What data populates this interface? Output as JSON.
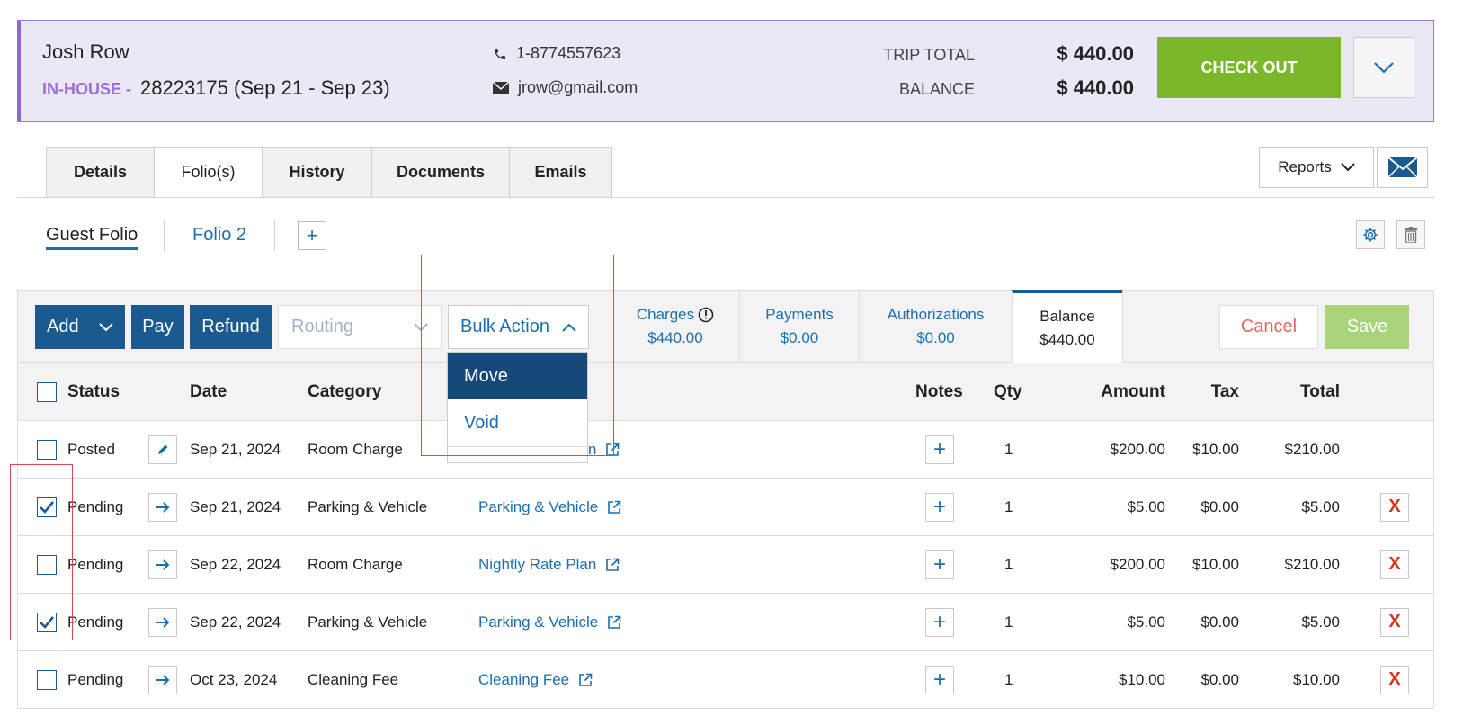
{
  "header": {
    "guest_name": "Josh Row",
    "status": "IN-HOUSE -",
    "reservation": "28223175 (Sep 21 - Sep 23)",
    "phone": "1-8774557623",
    "email": "jrow@gmail.com",
    "trip_total_label": "TRIP TOTAL",
    "trip_total_value": "$ 440.00",
    "balance_label": "BALANCE",
    "balance_value": "$ 440.00",
    "checkout_label": "CHECK OUT"
  },
  "tabs": [
    "Details",
    "Folio(s)",
    "History",
    "Documents",
    "Emails"
  ],
  "active_tab": "Folio(s)",
  "reports_label": "Reports",
  "folios": {
    "guest": "Guest Folio",
    "second": "Folio 2",
    "add": "+"
  },
  "toolbar": {
    "add": "Add",
    "pay": "Pay",
    "refund": "Refund",
    "routing_placeholder": "Routing",
    "bulk_action": "Bulk Action",
    "cancel": "Cancel",
    "save": "Save"
  },
  "summary": [
    {
      "label": "Charges",
      "value": "$440.00"
    },
    {
      "label": "Payments",
      "value": "$0.00"
    },
    {
      "label": "Authorizations",
      "value": "$0.00"
    },
    {
      "label": "Balance",
      "value": "$440.00"
    }
  ],
  "bulk_menu": [
    "Move",
    "Void"
  ],
  "table": {
    "columns": [
      "Status",
      "Date",
      "Category",
      "Notes",
      "Qty",
      "Amount",
      "Tax",
      "Total"
    ],
    "rows": [
      {
        "checked": false,
        "status": "Posted",
        "date": "Sep 21, 2024",
        "category": "Room Charge",
        "item": "n",
        "qty": "1",
        "amount": "$200.00",
        "tax": "$10.00",
        "total": "$210.00"
      },
      {
        "checked": true,
        "status": "Pending",
        "date": "Sep 21, 2024",
        "category": "Parking & Vehicle",
        "item": "Parking & Vehicle",
        "qty": "1",
        "amount": "$5.00",
        "tax": "$0.00",
        "total": "$5.00"
      },
      {
        "checked": false,
        "status": "Pending",
        "date": "Sep 22, 2024",
        "category": "Room Charge",
        "item": "Nightly Rate Plan",
        "qty": "1",
        "amount": "$200.00",
        "tax": "$10.00",
        "total": "$210.00"
      },
      {
        "checked": true,
        "status": "Pending",
        "date": "Sep 22, 2024",
        "category": "Parking & Vehicle",
        "item": "Parking & Vehicle",
        "qty": "1",
        "amount": "$5.00",
        "tax": "$0.00",
        "total": "$5.00"
      },
      {
        "checked": false,
        "status": "Pending",
        "date": "Oct 23, 2024",
        "category": "Cleaning Fee",
        "item": "Cleaning Fee",
        "qty": "1",
        "amount": "$10.00",
        "tax": "$0.00",
        "total": "$10.00"
      }
    ],
    "delete_label": "X"
  },
  "colors": {
    "primary": "#1a5a8e",
    "link": "#1a6fb0",
    "checkout": "#7ab82a",
    "save": "#a8d37a",
    "header_bg": "#eae8f5",
    "highlight": "#e2454a"
  }
}
